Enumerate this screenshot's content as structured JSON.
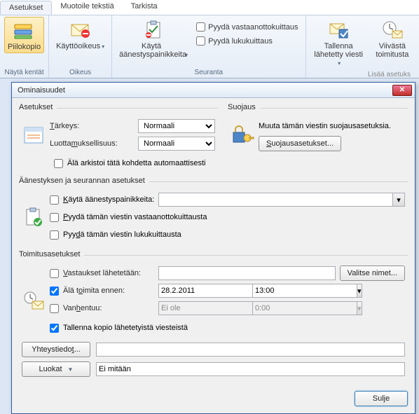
{
  "ribbon": {
    "tabs": [
      "Asetukset",
      "Muotoile tekstiä",
      "Tarkista"
    ],
    "active_tab": 0,
    "groups": {
      "show_fields": {
        "title": "Näytä kentät",
        "bcc": "Piilokopio"
      },
      "permission": {
        "title": "Oikeus",
        "btn": "Käyttöoikeus"
      },
      "tracking": {
        "title": "Seuranta",
        "voting": "Käytä äänestyspainikkeita",
        "receipt_delivery": "Pyydä vastaanottokuittaus",
        "receipt_read": "Pyydä lukukuittaus"
      },
      "more": {
        "save_sent": "Tallenna lähetetty viesti",
        "delay": "Viivästä toimitusta",
        "more_link": "Lisää asetuks"
      }
    }
  },
  "dialog": {
    "title": "Ominaisuudet",
    "settings": {
      "legend": "Asetukset",
      "importance_label": "Tärkeys:",
      "importance_value": "Normaali",
      "sensitivity_label": "Luottamuksellisuus:",
      "sensitivity_value": "Normaali",
      "no_autoarchive": "Älä arkistoi tätä kohdetta automaattisesti"
    },
    "security": {
      "legend": "Suojaus",
      "text": "Muuta tämän viestin suojausasetuksia.",
      "button": "Suojausasetukset..."
    },
    "voting": {
      "legend": "Äänestyksen ja seurannan asetukset",
      "use_voting": "Käytä äänestyspainikkeita:",
      "req_delivery": "Pyydä tämän viestin vastaanottokuittausta",
      "req_read": "Pyydä tämän viestin lukukuittausta"
    },
    "delivery": {
      "legend": "Toimitusasetukset",
      "replies_to": "Vastaukset lähetetään:",
      "select_names": "Valitse nimet...",
      "no_deliver_before": "Älä toimita ennen:",
      "date_value": "28.2.2011",
      "time_value": "13:00",
      "expires": "Vanhentuu:",
      "expires_date": "Ei ole",
      "expires_time": "0:00",
      "save_copy": "Tallenna kopio lähetetyistä viesteistä",
      "contacts": "Yhteystiedot...",
      "categories": "Luokat",
      "categories_value": "Ei mitään"
    },
    "close": "Sulje"
  }
}
